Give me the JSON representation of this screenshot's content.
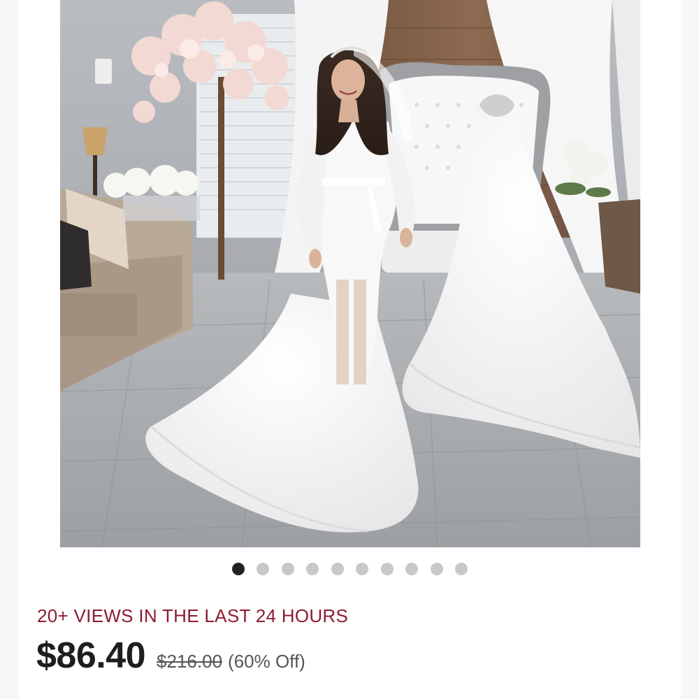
{
  "product": {
    "image_alt": "Bride in white lace robe beside a wedding gown on a mannequin",
    "carousel": {
      "total": 10,
      "active_index": 0
    },
    "views_text": "20+ VIEWS IN THE LAST 24 HOURS",
    "price_current": "$86.40",
    "price_original": "$216.00",
    "discount_text": "(60% Off)"
  },
  "colors": {
    "views_accent": "#8c1c32",
    "price_text": "#1e1e1e",
    "dot_active": "#222222",
    "dot_inactive": "#c8c8c8"
  }
}
